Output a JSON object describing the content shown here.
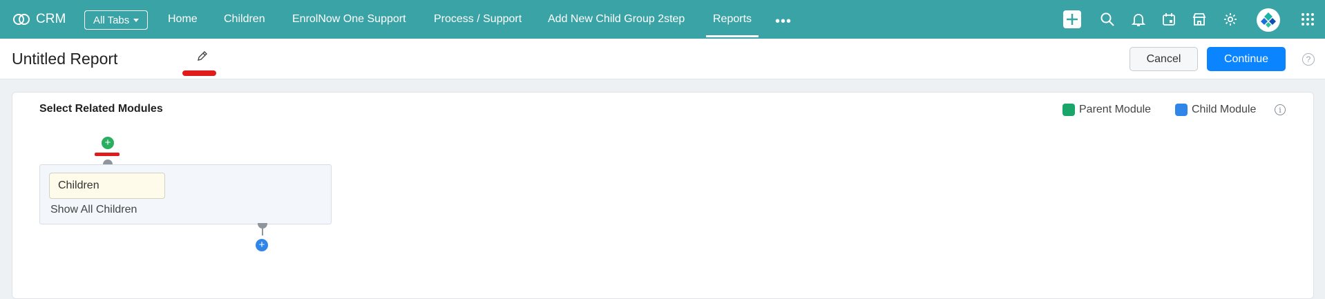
{
  "app": {
    "name": "CRM"
  },
  "topnav": {
    "all_tabs": "All Tabs",
    "items": [
      {
        "label": "Home"
      },
      {
        "label": "Children"
      },
      {
        "label": "EnrolNow One Support"
      },
      {
        "label": "Process / Support"
      },
      {
        "label": "Add New Child Group 2step"
      },
      {
        "label": "Reports",
        "active": true
      }
    ],
    "more": "•••",
    "icons": [
      "add-icon",
      "search-icon",
      "bell-icon",
      "calendar-icon",
      "marketplace-icon",
      "gear-icon",
      "avatar",
      "apps-grid-icon"
    ]
  },
  "report": {
    "title": "Untitled Report",
    "cancel_label": "Cancel",
    "continue_label": "Continue",
    "help": "?"
  },
  "modules": {
    "heading": "Select Related Modules",
    "legend": [
      {
        "label": "Parent Module",
        "color": "#1aa66b"
      },
      {
        "label": "Child Module",
        "color": "#2f86e8"
      }
    ],
    "info": "i",
    "selected_module": "Children",
    "filter": "Show All Children",
    "add": "+"
  },
  "colors": {
    "header": "#3aa3a6",
    "primary": "#0a84ff",
    "annotation": "#e01b1b"
  }
}
